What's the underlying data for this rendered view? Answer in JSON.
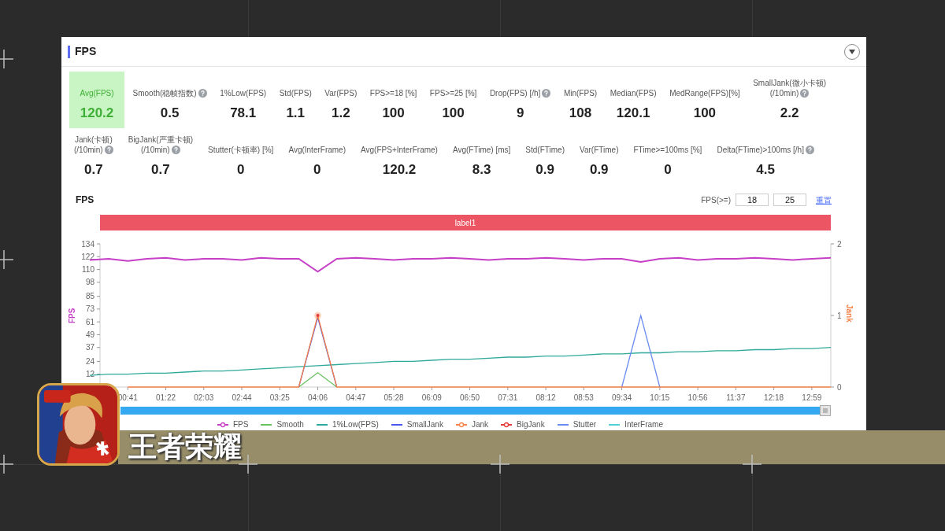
{
  "panel": {
    "title": "FPS"
  },
  "stats_rows": [
    [
      {
        "label_lines": [
          "Avg(FPS)"
        ],
        "value": "120.2",
        "highlighted": true,
        "help": false
      },
      {
        "label_lines": [
          "Smooth(稳帧指数)"
        ],
        "value": "0.5",
        "highlighted": false,
        "help": true
      },
      {
        "label_lines": [
          "1%Low(FPS)"
        ],
        "value": "78.1",
        "highlighted": false,
        "help": false
      },
      {
        "label_lines": [
          "Std(FPS)"
        ],
        "value": "1.1",
        "highlighted": false,
        "help": false
      },
      {
        "label_lines": [
          "Var(FPS)"
        ],
        "value": "1.2",
        "highlighted": false,
        "help": false
      },
      {
        "label_lines": [
          "FPS>=18 [%]"
        ],
        "value": "100",
        "highlighted": false,
        "help": false
      },
      {
        "label_lines": [
          "FPS>=25 [%]"
        ],
        "value": "100",
        "highlighted": false,
        "help": false
      },
      {
        "label_lines": [
          "Drop(FPS) [/h]"
        ],
        "value": "9",
        "highlighted": false,
        "help": true
      },
      {
        "label_lines": [
          "Min(FPS)"
        ],
        "value": "108",
        "highlighted": false,
        "help": false
      },
      {
        "label_lines": [
          "Median(FPS)"
        ],
        "value": "120.1",
        "highlighted": false,
        "help": false
      },
      {
        "label_lines": [
          "MedRange(FPS)[%]"
        ],
        "value": "100",
        "highlighted": false,
        "help": false
      },
      {
        "label_lines": [
          "SmallJank(微小卡顿)",
          "(/10min)"
        ],
        "value": "2.2",
        "highlighted": false,
        "help": true
      }
    ],
    [
      {
        "label_lines": [
          "Jank(卡顿)",
          "(/10min)"
        ],
        "value": "0.7",
        "highlighted": false,
        "help": true
      },
      {
        "label_lines": [
          "BigJank(严重卡顿)",
          "(/10min)"
        ],
        "value": "0.7",
        "highlighted": false,
        "help": true
      },
      {
        "label_lines": [
          "Stutter(卡顿率) [%]"
        ],
        "value": "0",
        "highlighted": false,
        "help": false
      },
      {
        "label_lines": [
          "Avg(InterFrame)"
        ],
        "value": "0",
        "highlighted": false,
        "help": false
      },
      {
        "label_lines": [
          "Avg(FPS+InterFrame)"
        ],
        "value": "120.2",
        "highlighted": false,
        "help": false
      },
      {
        "label_lines": [
          "Avg(FTime) [ms]"
        ],
        "value": "8.3",
        "highlighted": false,
        "help": false
      },
      {
        "label_lines": [
          "Std(FTime)"
        ],
        "value": "0.9",
        "highlighted": false,
        "help": false
      },
      {
        "label_lines": [
          "Var(FTime)"
        ],
        "value": "0.9",
        "highlighted": false,
        "help": false
      },
      {
        "label_lines": [
          "FTime>=100ms [%]"
        ],
        "value": "0",
        "highlighted": false,
        "help": false
      },
      {
        "label_lines": [
          "Delta(FTime)>100ms [/h]"
        ],
        "value": "4.5",
        "highlighted": false,
        "help": true
      }
    ]
  ],
  "chart_section": {
    "title": "FPS",
    "threshold_label": "FPS(>=)",
    "thresholds": [
      "18",
      "25"
    ],
    "reset_link": "重置",
    "label_bar": "label1",
    "chart_data": {
      "type": "line",
      "ylabel": "FPS",
      "y2label": "Jank",
      "ylim": [
        0,
        134
      ],
      "y2lim": [
        0,
        2
      ],
      "categories": [
        null,
        null,
        "00:41",
        null,
        "01:22",
        null,
        "02:03",
        null,
        "02:44",
        null,
        "03:25",
        null,
        "04:06",
        null,
        "04:47",
        null,
        "05:28",
        null,
        "06:09",
        null,
        "06:50",
        null,
        "07:31",
        null,
        "08:12",
        null,
        "08:53",
        null,
        "09:34",
        null,
        "10:15",
        null,
        "10:56",
        null,
        "11:37",
        null,
        "12:18",
        null,
        "12:59",
        null
      ],
      "yticks": [
        12,
        24,
        37,
        49,
        61,
        73,
        85,
        98,
        110,
        122,
        134
      ],
      "y2ticks": [
        0,
        1,
        2
      ],
      "series": [
        {
          "name": "FPS",
          "color": "#c63fc6",
          "marker": true,
          "values": [
            119,
            120,
            118,
            120,
            121,
            119,
            120,
            120,
            119,
            121,
            120,
            120,
            108,
            120,
            121,
            120,
            119,
            120,
            120,
            121,
            120,
            119,
            120,
            120,
            121,
            120,
            119,
            120,
            120,
            117,
            120,
            121,
            119,
            120,
            120,
            121,
            120,
            119,
            120,
            121
          ]
        },
        {
          "name": "Smooth",
          "color": "#67c25f",
          "axis": "y2",
          "marker": false,
          "values": [
            null,
            null,
            null,
            null,
            null,
            null,
            null,
            null,
            null,
            null,
            null,
            0,
            0.2,
            0,
            null,
            null,
            null,
            null,
            null,
            null,
            null,
            null,
            null,
            null,
            null,
            null,
            null,
            null,
            null,
            null,
            null,
            null,
            null,
            null,
            null,
            null,
            null,
            null,
            null,
            null
          ]
        },
        {
          "name": "1%Low(FPS)",
          "color": "#2fa99b",
          "marker": false,
          "values": [
            11,
            12,
            12,
            13,
            13,
            14,
            15,
            15,
            16,
            17,
            18,
            19,
            20,
            21,
            22,
            23,
            24,
            24,
            25,
            26,
            26,
            27,
            28,
            28,
            29,
            29,
            30,
            31,
            31,
            32,
            32,
            33,
            33,
            34,
            34,
            35,
            35,
            36,
            36,
            37
          ]
        },
        {
          "name": "SmallJank",
          "color": "#4b57ee",
          "axis": "y2",
          "marker": false,
          "values": [
            null,
            null,
            null,
            null,
            null,
            null,
            null,
            null,
            null,
            null,
            null,
            0,
            0.97,
            0,
            null,
            null,
            null,
            null,
            null,
            null,
            null,
            null,
            null,
            null,
            null,
            null,
            null,
            null,
            null,
            null,
            null,
            null,
            null,
            null,
            null,
            null,
            null,
            null,
            null,
            null
          ]
        },
        {
          "name": "Jank",
          "color": "#f7834a",
          "axis": "y2",
          "marker": true,
          "values": [
            null,
            null,
            0,
            0,
            0,
            0,
            0,
            0,
            0,
            0,
            0,
            0,
            1,
            0,
            0,
            0,
            0,
            0,
            0,
            0,
            0,
            0,
            0,
            0,
            0,
            0,
            0,
            0,
            0,
            0,
            0,
            0,
            0,
            0,
            0,
            0,
            0,
            0,
            0,
            0
          ]
        },
        {
          "name": "BigJank",
          "color": "#e8393a",
          "axis": "y2",
          "marker": true,
          "values": [
            null,
            null,
            null,
            null,
            null,
            null,
            null,
            null,
            null,
            null,
            null,
            null,
            null,
            null,
            null,
            null,
            null,
            null,
            null,
            null,
            null,
            null,
            null,
            null,
            null,
            null,
            null,
            null,
            null,
            null,
            null,
            null,
            null,
            null,
            null,
            null,
            null,
            null,
            null,
            null
          ]
        },
        {
          "name": "Stutter",
          "color": "#6a8cf0",
          "axis": "y2",
          "marker": false,
          "values": [
            null,
            null,
            null,
            null,
            null,
            null,
            null,
            null,
            null,
            null,
            null,
            null,
            null,
            null,
            null,
            null,
            null,
            null,
            null,
            null,
            null,
            null,
            null,
            null,
            null,
            null,
            null,
            null,
            0,
            1,
            0,
            null,
            null,
            null,
            null,
            null,
            null,
            null,
            null,
            null
          ]
        },
        {
          "name": "InterFrame",
          "color": "#4ed0d6",
          "marker": false,
          "values": [
            null,
            null,
            null,
            null,
            null,
            null,
            null,
            null,
            null,
            null,
            null,
            null,
            null,
            null,
            null,
            null,
            null,
            null,
            null,
            null,
            null,
            null,
            null,
            null,
            null,
            null,
            null,
            null,
            null,
            null,
            null,
            null,
            null,
            null,
            null,
            null,
            null,
            null,
            null,
            null
          ]
        }
      ]
    },
    "zoom_slider": {
      "level": 0.985
    }
  },
  "caption": {
    "title": "王者荣耀"
  },
  "app_icon": {
    "kind": "picture"
  }
}
